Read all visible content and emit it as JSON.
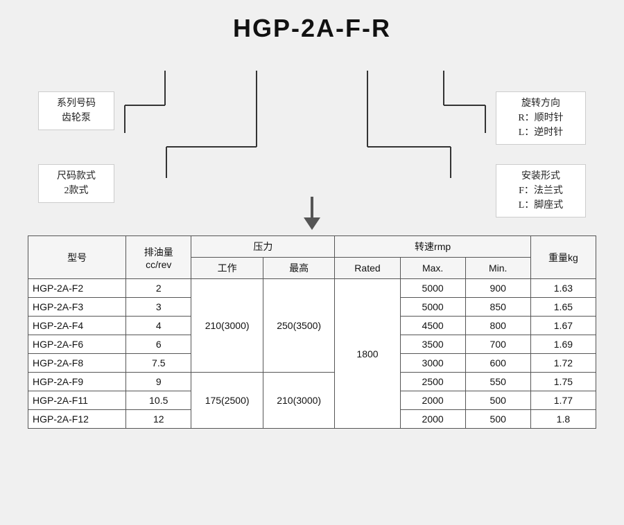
{
  "title": "HGP-2A-F-R",
  "labels": {
    "left_top_line1": "系列号码",
    "left_top_line2": "齿轮泵",
    "left_bottom_line1": "尺码款式",
    "left_bottom_line2": "2款式",
    "right_top_line1": "旋转方向",
    "right_top_line2": "R：顺时针",
    "right_top_line3": "L：逆时针",
    "right_bottom_line1": "安装形式",
    "right_bottom_line2": "F：法兰式",
    "right_bottom_line3": "L：脚座式"
  },
  "table": {
    "headers": {
      "model": "型号",
      "displacement": "排油量\ncc/rev",
      "pressure_group": "压力",
      "pressure_work": "工作",
      "pressure_max": "最高",
      "speed_group": "转速rmp",
      "speed_rated": "Rated",
      "speed_max": "Max.",
      "speed_min": "Min.",
      "weight": "重量kg"
    },
    "rows": [
      {
        "model": "HGP-2A-F2",
        "disp": "2",
        "work": "210(3000)",
        "max_p": "250(3500)",
        "rated": "1800",
        "max_rpm": "5000",
        "min_rpm": "900",
        "weight": "1.63"
      },
      {
        "model": "HGP-2A-F3",
        "disp": "3",
        "work": "",
        "max_p": "",
        "rated": "",
        "max_rpm": "5000",
        "min_rpm": "850",
        "weight": "1.65"
      },
      {
        "model": "HGP-2A-F4",
        "disp": "4",
        "work": "",
        "max_p": "",
        "rated": "",
        "max_rpm": "4500",
        "min_rpm": "800",
        "weight": "1.67"
      },
      {
        "model": "HGP-2A-F6",
        "disp": "6",
        "work": "",
        "max_p": "",
        "rated": "",
        "max_rpm": "3500",
        "min_rpm": "700",
        "weight": "1.69"
      },
      {
        "model": "HGP-2A-F8",
        "disp": "7.5",
        "work": "",
        "max_p": "",
        "rated": "",
        "max_rpm": "3000",
        "min_rpm": "600",
        "weight": "1.72"
      },
      {
        "model": "HGP-2A-F9",
        "disp": "9",
        "work": "175(2500)",
        "max_p": "210(3000)",
        "rated": "",
        "max_rpm": "2500",
        "min_rpm": "550",
        "weight": "1.75"
      },
      {
        "model": "HGP-2A-F11",
        "disp": "10.5",
        "work": "",
        "max_p": "",
        "rated": "",
        "max_rpm": "2000",
        "min_rpm": "500",
        "weight": "1.77"
      },
      {
        "model": "HGP-2A-F12",
        "disp": "12",
        "work": "",
        "max_p": "",
        "rated": "",
        "max_rpm": "2000",
        "min_rpm": "500",
        "weight": "1.8"
      }
    ]
  }
}
